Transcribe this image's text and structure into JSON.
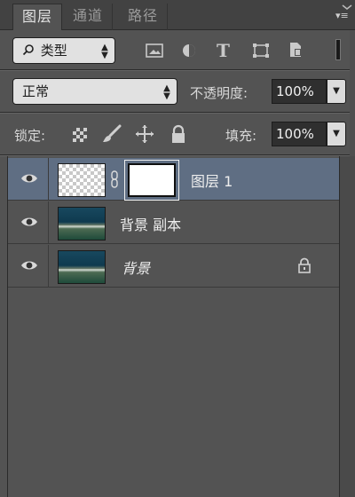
{
  "tabs": [
    {
      "label": "图层",
      "active": true
    },
    {
      "label": "通道",
      "active": false
    },
    {
      "label": "路径",
      "active": false
    }
  ],
  "filter": {
    "kind_label": "类型",
    "icons": [
      "image-filter-icon",
      "adjustment-filter-icon",
      "type-filter-icon",
      "shape-filter-icon",
      "smart-object-filter-icon"
    ]
  },
  "blend": {
    "mode": "正常",
    "opacity_label": "不透明度:",
    "opacity_value": "100%"
  },
  "lock": {
    "label": "锁定:",
    "icons": [
      "lock-transparent-icon",
      "lock-image-icon",
      "lock-position-icon",
      "lock-all-icon"
    ],
    "fill_label": "填充:",
    "fill_value": "100%"
  },
  "layers": [
    {
      "name": "图层 1",
      "selected": true,
      "visible": true,
      "has_mask": true,
      "thumb": "transparent",
      "italic": false,
      "locked": false
    },
    {
      "name": "背景 副本",
      "selected": false,
      "visible": true,
      "has_mask": false,
      "thumb": "photo",
      "italic": false,
      "locked": false
    },
    {
      "name": "背景",
      "selected": false,
      "visible": true,
      "has_mask": false,
      "thumb": "photo",
      "italic": true,
      "locked": true
    }
  ],
  "colors": {
    "panel_bg": "#535353",
    "selected_row": "#5f6e83",
    "control_bg": "#e1e1e1"
  }
}
